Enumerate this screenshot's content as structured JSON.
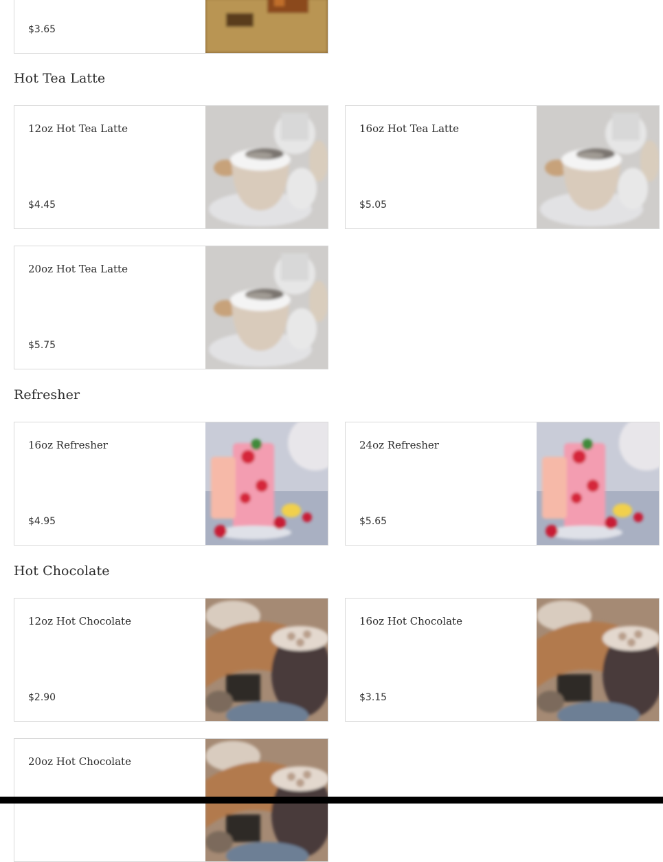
{
  "top_partial": {
    "price": "$3.65",
    "image": "tea-drink-photo"
  },
  "sections": [
    {
      "title": "Hot Tea Latte",
      "image": "tea-latte-photo",
      "items": [
        {
          "name": "12oz Hot Tea Latte",
          "price": "$4.45"
        },
        {
          "name": "16oz Hot Tea Latte",
          "price": "$5.05"
        },
        {
          "name": "20oz Hot Tea Latte",
          "price": "$5.75"
        }
      ]
    },
    {
      "title": "Refresher",
      "image": "refresher-photo",
      "items": [
        {
          "name": "16oz Refresher",
          "price": "$4.95"
        },
        {
          "name": "24oz Refresher",
          "price": "$5.65"
        }
      ]
    },
    {
      "title": "Hot Chocolate",
      "image": "hot-chocolate-photo",
      "items": [
        {
          "name": "12oz Hot Chocolate",
          "price": "$2.90"
        },
        {
          "name": "16oz Hot Chocolate",
          "price": "$3.15"
        },
        {
          "name": "20oz Hot Chocolate",
          "price": ""
        }
      ]
    }
  ]
}
